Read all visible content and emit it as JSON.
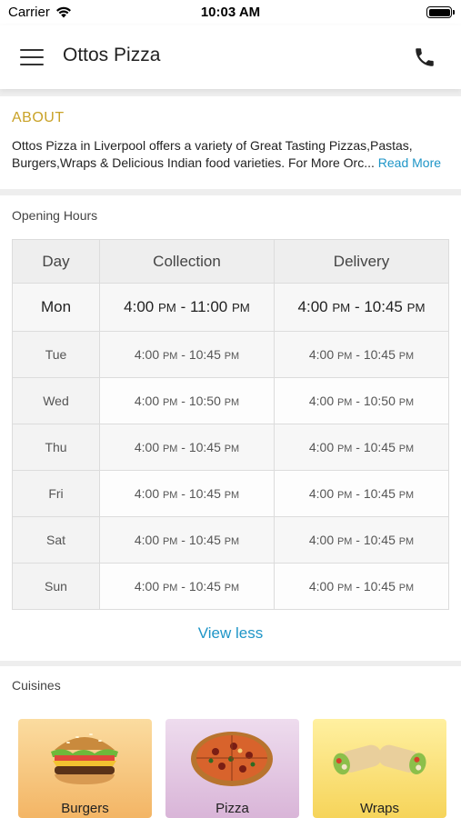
{
  "status_bar": {
    "carrier": "Carrier",
    "time": "10:03 AM"
  },
  "app_bar": {
    "title": "Ottos Pizza",
    "menu_icon": "hamburger-menu-icon",
    "call_icon": "phone-icon"
  },
  "about": {
    "title": "ABOUT",
    "text_line1": "Ottos Pizza in Liverpool offers a variety of Great Tasting Pizzas,Pastas,",
    "text_line2": "Burgers,Wraps & Delicious Indian food varieties. For More Orc...",
    "read_more": "Read More"
  },
  "hours": {
    "title": "Opening Hours",
    "headers": {
      "day": "Day",
      "collection": "Collection",
      "delivery": "Delivery"
    },
    "rows": [
      {
        "day": "Mon",
        "c_open": "4:00",
        "c_open_ampm": "PM",
        "c_close": "11:00",
        "c_close_ampm": "PM",
        "d_open": "4:00",
        "d_open_ampm": "PM",
        "d_close": "10:45",
        "d_close_ampm": "PM"
      },
      {
        "day": "Tue",
        "c_open": "4:00",
        "c_open_ampm": "PM",
        "c_close": "10:45",
        "c_close_ampm": "PM",
        "d_open": "4:00",
        "d_open_ampm": "PM",
        "d_close": "10:45",
        "d_close_ampm": "PM"
      },
      {
        "day": "Wed",
        "c_open": "4:00",
        "c_open_ampm": "PM",
        "c_close": "10:50",
        "c_close_ampm": "PM",
        "d_open": "4:00",
        "d_open_ampm": "PM",
        "d_close": "10:50",
        "d_close_ampm": "PM"
      },
      {
        "day": "Thu",
        "c_open": "4:00",
        "c_open_ampm": "PM",
        "c_close": "10:45",
        "c_close_ampm": "PM",
        "d_open": "4:00",
        "d_open_ampm": "PM",
        "d_close": "10:45",
        "d_close_ampm": "PM"
      },
      {
        "day": "Fri",
        "c_open": "4:00",
        "c_open_ampm": "PM",
        "c_close": "10:45",
        "c_close_ampm": "PM",
        "d_open": "4:00",
        "d_open_ampm": "PM",
        "d_close": "10:45",
        "d_close_ampm": "PM"
      },
      {
        "day": "Sat",
        "c_open": "4:00",
        "c_open_ampm": "PM",
        "c_close": "10:45",
        "c_close_ampm": "PM",
        "d_open": "4:00",
        "d_open_ampm": "PM",
        "d_close": "10:45",
        "d_close_ampm": "PM"
      },
      {
        "day": "Sun",
        "c_open": "4:00",
        "c_open_ampm": "PM",
        "c_close": "10:45",
        "c_close_ampm": "PM",
        "d_open": "4:00",
        "d_open_ampm": "PM",
        "d_close": "10:45",
        "d_close_ampm": "PM"
      }
    ],
    "view_less": "View less"
  },
  "cuisines": {
    "title": "Cuisines",
    "items": [
      {
        "label": "Burgers",
        "icon": "burger-icon",
        "color": "#f3b565"
      },
      {
        "label": "Pizza",
        "icon": "pizza-icon",
        "color": "#d9b5d8"
      },
      {
        "label": "Wraps",
        "icon": "wrap-icon",
        "color": "#f6d45a"
      }
    ]
  },
  "colors": {
    "accent_gold": "#c9a227",
    "link_blue": "#1e95c7"
  }
}
